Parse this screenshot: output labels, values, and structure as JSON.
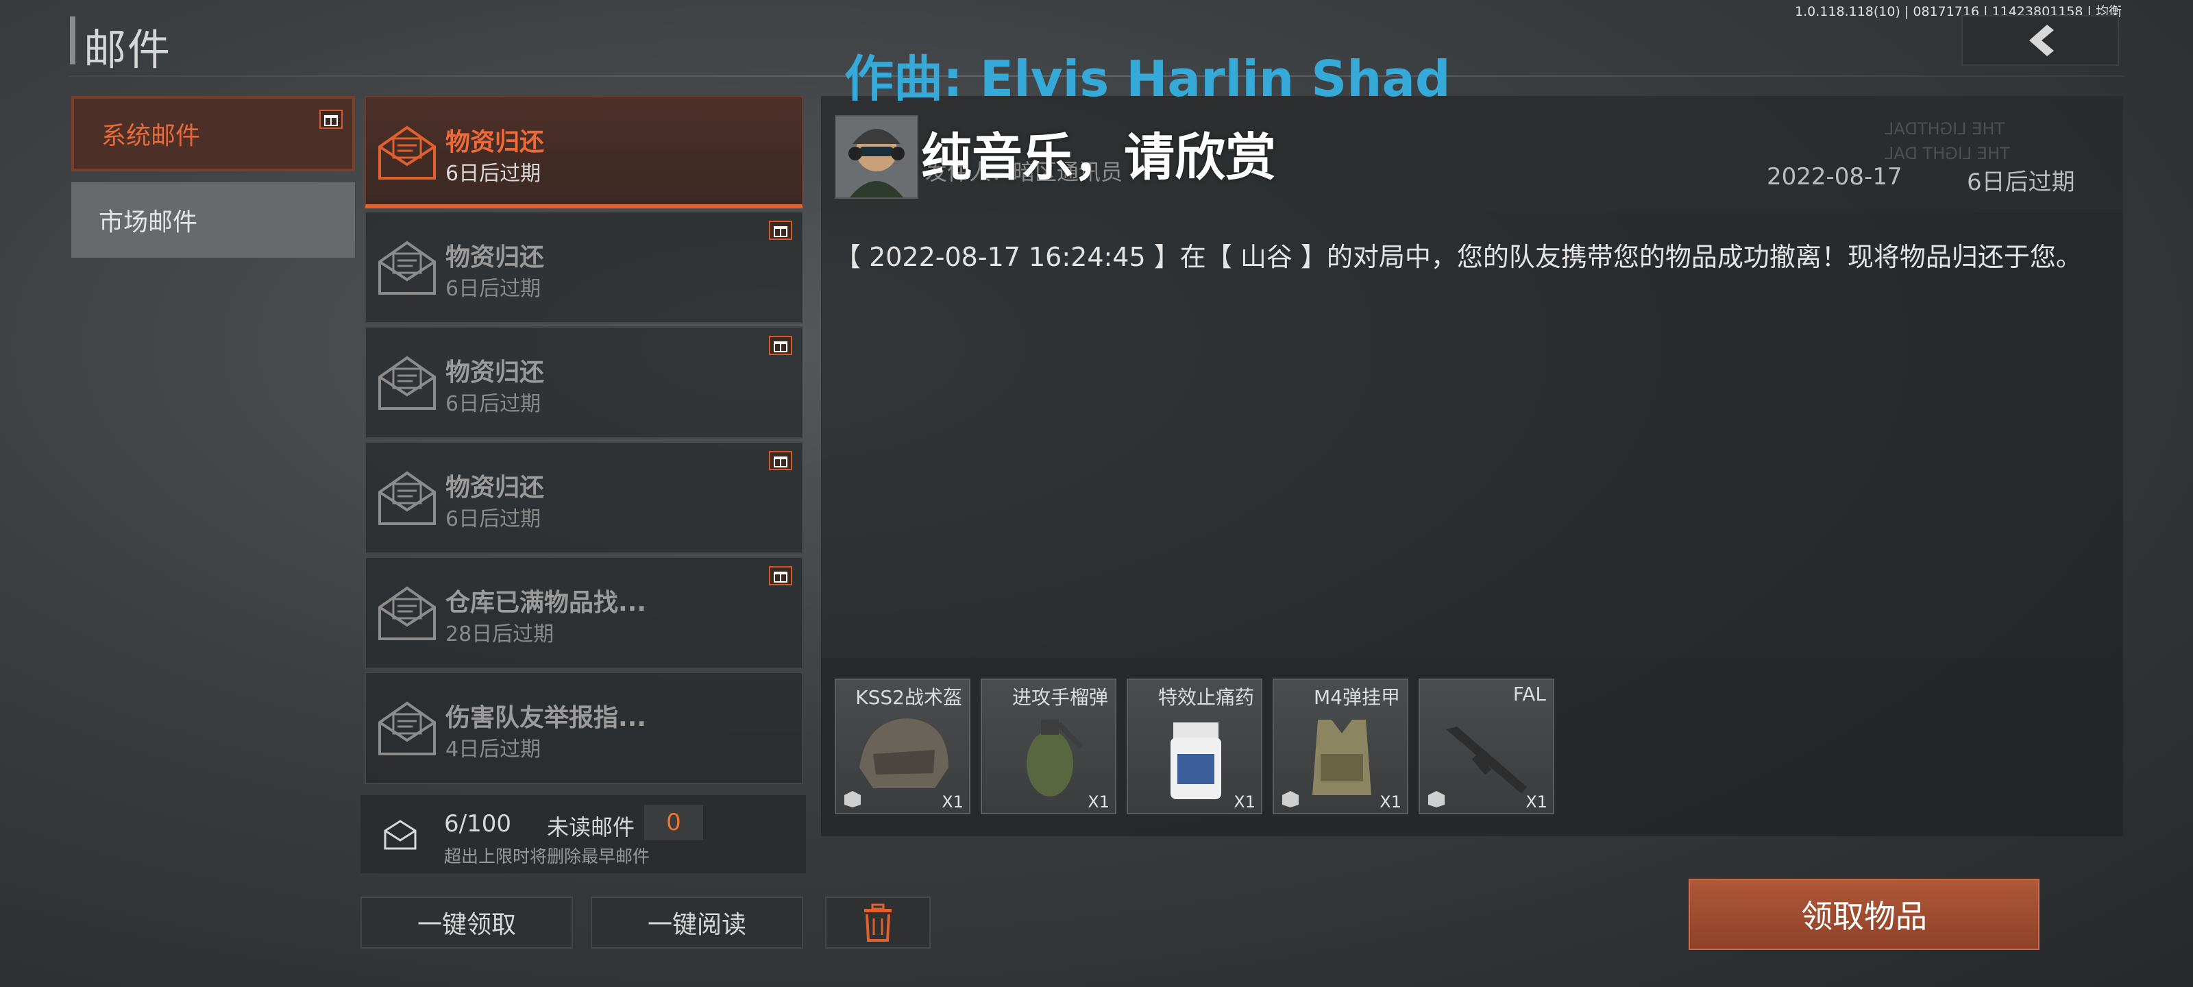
{
  "header": {
    "title": "邮件",
    "version": "1.0.118.118(10) | 08171716 | 11423801158 | 均衡",
    "back_icon": "chevron-left-icon"
  },
  "overlay": {
    "composer": "作曲: Elvis Harlin Shad",
    "caption": "纯音乐，请欣赏"
  },
  "categories": [
    {
      "label": "系统邮件",
      "active": true,
      "badge_icon": "gift-icon"
    },
    {
      "label": "市场邮件",
      "active": false
    }
  ],
  "mail_list": [
    {
      "title": "物资归还",
      "expire": "6日后过期",
      "active": true
    },
    {
      "title": "物资归还",
      "expire": "6日后过期",
      "badge_icon": "gift-icon"
    },
    {
      "title": "物资归还",
      "expire": "6日后过期",
      "badge_icon": "gift-icon"
    },
    {
      "title": "物资归还",
      "expire": "6日后过期",
      "badge_icon": "gift-icon"
    },
    {
      "title": "仓库已满物品找...",
      "expire": "28日后过期",
      "badge_icon": "gift-icon"
    },
    {
      "title": "伤害队友举报指...",
      "expire": "4日后过期"
    }
  ],
  "footer": {
    "count": "6/100",
    "unread_label": "未读邮件",
    "unread_count": "0",
    "limit_note": "超出上限时将删除最早邮件",
    "claim_all": "一键领取",
    "read_all": "一键阅读",
    "delete_icon": "trash-icon"
  },
  "detail": {
    "sender": "发件人：暗区通讯员",
    "date": "2022-08-17",
    "expire": "6日后过期",
    "watermark": [
      "THE LIGHTDAL",
      "THE LIGHT DAL"
    ],
    "body": "【 2022-08-17 16:24:45 】在【 山谷 】的对局中，您的队友携带您的物品成功撤离！现将物品归还于您。",
    "attachments": [
      {
        "name": "KSS2战术盔",
        "qty": "X1"
      },
      {
        "name": "进攻手榴弹",
        "qty": "X1"
      },
      {
        "name": "特效止痛药",
        "qty": "X1"
      },
      {
        "name": "M4弹挂甲",
        "qty": "X1"
      },
      {
        "name": "FAL",
        "qty": "X1"
      }
    ],
    "claim_button": "领取物品"
  },
  "colors": {
    "accent": "#e0602e",
    "claim_button": "#9e4a2f",
    "overlay_blue": "#35a9d8"
  }
}
